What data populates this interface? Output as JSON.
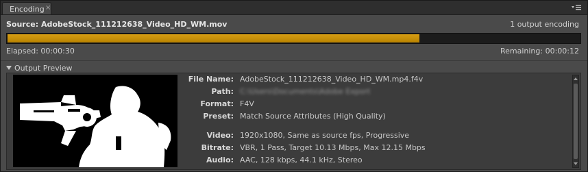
{
  "tab": {
    "label": "Encoding",
    "close_glyph": "×"
  },
  "panel_menu_icon": "panel-menu-icon",
  "source": {
    "label": "Source: AdobeStock_111212638_Video_HD_WM.mov"
  },
  "output_count": "1 output encoding",
  "progress": {
    "fraction": 0.72,
    "color": "#c08a00"
  },
  "elapsed": "Elapsed: 00:00:30",
  "remaining": "Remaining: 00:00:12",
  "preview": {
    "title": "Output Preview",
    "fields": [
      {
        "label": "File Name:",
        "value": "AdobeStock_111212638_Video_HD_WM.mp4.f4v"
      },
      {
        "label": "Path:",
        "value": "C:\\Users\\Documents\\Adobe Export"
      },
      {
        "label": "Format:",
        "value": "F4V"
      },
      {
        "label": "Preset:",
        "value": "Match Source Attributes (High Quality)"
      },
      {
        "label": "Video:",
        "value": "1920x1080, Same as source fps, Progressive"
      },
      {
        "label": "Bitrate:",
        "value": "VBR, 1 Pass, Target 10.13 Mbps, Max 12.15 Mbps"
      },
      {
        "label": "Audio:",
        "value": "AAC, 128 kbps, 44.1 kHz, Stereo"
      }
    ]
  }
}
